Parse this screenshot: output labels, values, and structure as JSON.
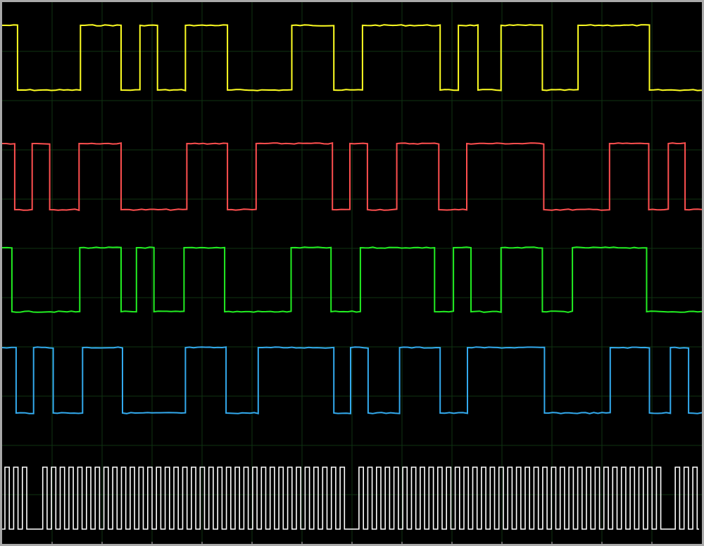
{
  "screen": {
    "background": "#000000",
    "border": "#a9a9a9",
    "grid": "#0f3312",
    "tick": "#c8c8c8"
  },
  "chart_data": {
    "type": "line",
    "title": "",
    "xlabel": "",
    "ylabel": "",
    "grid": true,
    "legend": "none",
    "x_divisions": 14,
    "y_divisions": 11,
    "xlim": [
      0,
      1
    ],
    "series": [
      {
        "color": "#ffff22",
        "level": {
          "high": 0,
          "low": 1
        },
        "edges": [
          0,
          0.022,
          0.112,
          0.17,
          0.197,
          0.222,
          0.262,
          0.322,
          0.414,
          0.474,
          0.515,
          0.626,
          0.652,
          0.68,
          0.713,
          0.772,
          0.823,
          0.925
        ]
      },
      {
        "color": "#ff4f4f",
        "level": {
          "high": 0,
          "low": 1
        },
        "edges": [
          0,
          0.018,
          0.043,
          0.068,
          0.11,
          0.17,
          0.264,
          0.322,
          0.363,
          0.472,
          0.497,
          0.522,
          0.564,
          0.624,
          0.664,
          0.774,
          0.868,
          0.924,
          0.952,
          0.976
        ]
      },
      {
        "color": "#22ee22",
        "level": {
          "high": 0,
          "low": 1
        },
        "edges": [
          0,
          0.014,
          0.111,
          0.17,
          0.192,
          0.217,
          0.26,
          0.318,
          0.413,
          0.47,
          0.512,
          0.618,
          0.645,
          0.67,
          0.713,
          0.772,
          0.815,
          0.921
        ]
      },
      {
        "color": "#33aaee",
        "level": {
          "high": 0,
          "low": 1
        },
        "edges": [
          0,
          0.02,
          0.045,
          0.073,
          0.115,
          0.172,
          0.262,
          0.32,
          0.366,
          0.474,
          0.498,
          0.523,
          0.568,
          0.626,
          0.665,
          0.775,
          0.869,
          0.925,
          0.955,
          0.981
        ]
      },
      {
        "color": "#ffffff",
        "level": {
          "high": 0,
          "low": 1
        },
        "period": 0.0125,
        "gaps": [
          [
            0.04,
            0.058
          ],
          [
            0.492,
            0.51
          ],
          [
            0.942,
            0.962
          ]
        ]
      }
    ]
  }
}
